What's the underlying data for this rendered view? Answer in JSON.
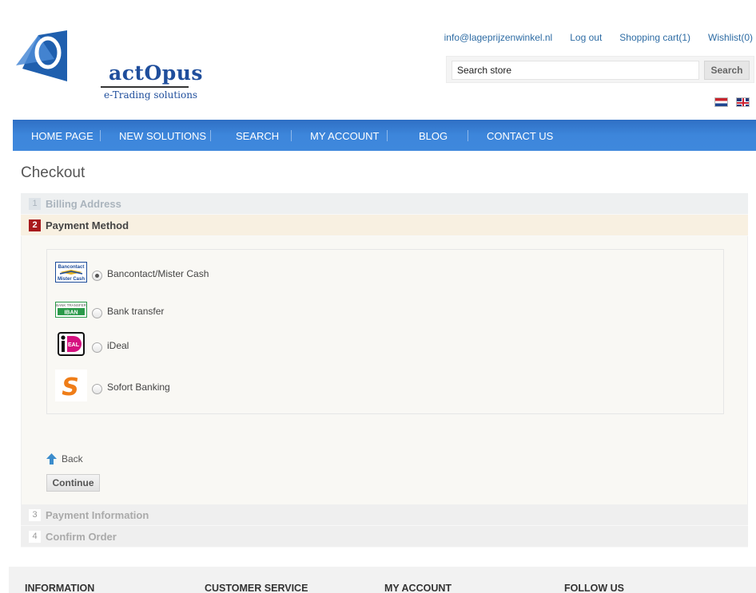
{
  "brand": {
    "name": "actOpus",
    "tagline": "e-Trading solutions"
  },
  "header_links": [
    {
      "label": "info@lageprijzenwinkel.nl"
    },
    {
      "label": "Log out"
    },
    {
      "label": "Shopping cart(1)"
    },
    {
      "label": "Wishlist(0)"
    }
  ],
  "search": {
    "value": "Search store",
    "button_label": "Search"
  },
  "languages": [
    {
      "icon": "flag-nl-icon"
    },
    {
      "icon": "flag-gb-icon"
    }
  ],
  "nav": [
    {
      "label": "HOME PAGE"
    },
    {
      "label": "NEW SOLUTIONS"
    },
    {
      "label": "SEARCH"
    },
    {
      "label": "MY ACCOUNT"
    },
    {
      "label": "BLOG"
    },
    {
      "label": "CONTACT US"
    }
  ],
  "checkout": {
    "title": "Checkout",
    "steps": [
      {
        "number": "1",
        "title": "Billing Address"
      },
      {
        "number": "2",
        "title": "Payment Method"
      },
      {
        "number": "3",
        "title": "Payment Information"
      },
      {
        "number": "4",
        "title": "Confirm Order"
      }
    ],
    "payment_methods": [
      {
        "label": "Bancontact/Mister Cash",
        "selected": true,
        "logo_lines": [
          "Bancontact",
          "Mister Cash"
        ]
      },
      {
        "label": "Bank transfer",
        "selected": false,
        "logo_lines": [
          "BANK TRANSFER",
          "IBAN"
        ]
      },
      {
        "label": "iDeal",
        "selected": false,
        "logo_lines": [
          "iD",
          "EAL"
        ]
      },
      {
        "label": "Sofort Banking",
        "selected": false,
        "logo_lines": [
          "S"
        ]
      }
    ],
    "back_label": "Back",
    "continue_label": "Continue"
  },
  "footer": {
    "columns": [
      {
        "title": "INFORMATION"
      },
      {
        "title": "CUSTOMER SERVICE"
      },
      {
        "title": "MY ACCOUNT"
      },
      {
        "title": "FOLLOW US"
      }
    ]
  },
  "colors": {
    "nav_blue": "#3d86db",
    "link_blue": "#2e6ca4",
    "active_step_red": "#a8191c",
    "active_step_bg": "#f8f0e1"
  }
}
